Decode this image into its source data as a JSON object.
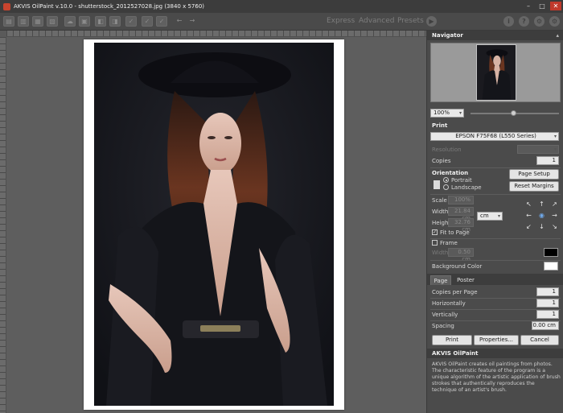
{
  "window": {
    "title": "AKVIS OilPaint v.10.0 - shutterstock_2012527028.jpg (3840 x 5760)",
    "controls": {
      "minimize": "–",
      "maximize": "□",
      "close": "✕"
    }
  },
  "toolbar": {
    "icons": [
      "open-icon",
      "save-icon",
      "batch-icon",
      "print-icon",
      "share-icon",
      "canvas-icon",
      "crop-icon",
      "before-after-icon",
      "check-icon",
      "run-icon",
      "apply-icon",
      "back-arrow-icon",
      "forward-arrow-icon"
    ],
    "tabs": [
      "Express",
      "Advanced",
      "Presets"
    ],
    "run_symbol": "▶",
    "info_symbol": "i",
    "help_symbol": "?",
    "settings_symbol": "⚙",
    "gear2_symbol": "⚙",
    "back_symbol": "←",
    "forward_symbol": "→"
  },
  "navigator": {
    "title": "Navigator",
    "zoom_value": "100%"
  },
  "print": {
    "title": "Print",
    "printer": "EPSON F75F68 (L550 Series)",
    "resolution_label": "Resolution",
    "copies_label": "Copies",
    "copies_value": "1",
    "orientation_label": "Orientation",
    "portrait_label": "Portrait",
    "landscape_label": "Landscape",
    "page_setup_button": "Page Setup",
    "reset_margins_button": "Reset Margins",
    "scale_label": "Scale",
    "scale_value": "100%",
    "width_label": "Width",
    "width_value": "21.84 cm",
    "height_label": "Height",
    "height_value": "32.76 cm",
    "unit_value": "cm",
    "fit_to_page_label": "Fit to Page",
    "frame_label": "Frame",
    "frame_width_label": "Width",
    "frame_width_value": "0.50 cm",
    "frame_color": "#000000",
    "background_color_label": "Background Color",
    "background_color": "#ffffff"
  },
  "tabs": {
    "page": "Page",
    "poster": "Poster"
  },
  "page_settings": {
    "copies_per_page_label": "Copies per Page",
    "copies_per_page_value": "1",
    "horizontally_label": "Horizontally",
    "horizontally_value": "1",
    "vertically_label": "Vertically",
    "vertically_value": "1",
    "spacing_label": "Spacing",
    "spacing_value": "0.00 cm"
  },
  "buttons": {
    "print": "Print",
    "properties": "Properties...",
    "cancel": "Cancel"
  },
  "about": {
    "title": "AKVIS OilPaint",
    "text": "AKVIS OilPaint creates oil paintings from photos. The characteristic feature of the program is a unique algorithm of the artistic application of brush strokes that authentically reproduces the technique of an artist's brush."
  }
}
